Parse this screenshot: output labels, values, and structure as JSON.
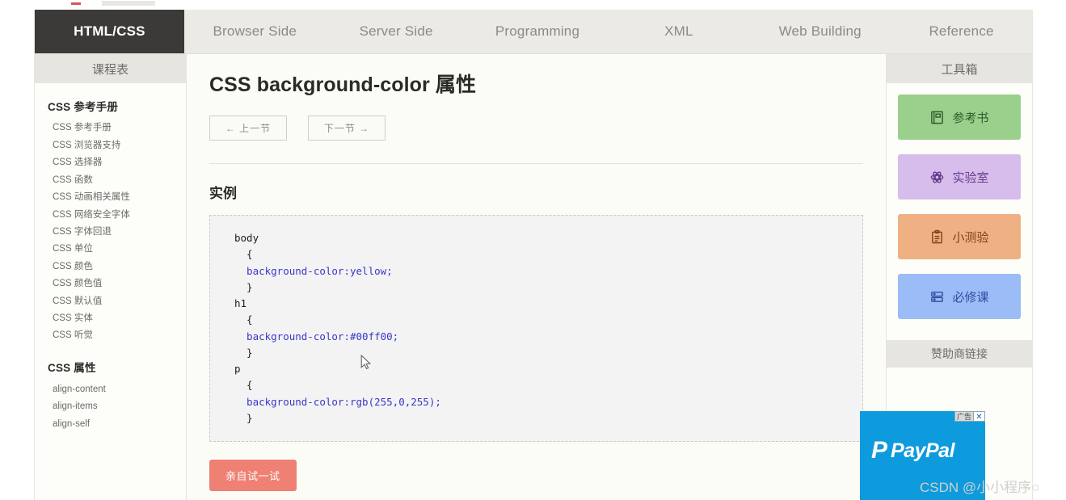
{
  "topnav": {
    "items": [
      {
        "label": "HTML/CSS",
        "active": true
      },
      {
        "label": "Browser Side",
        "active": false
      },
      {
        "label": "Server Side",
        "active": false
      },
      {
        "label": "Programming",
        "active": false
      },
      {
        "label": "XML",
        "active": false
      },
      {
        "label": "Web Building",
        "active": false
      },
      {
        "label": "Reference",
        "active": false
      }
    ]
  },
  "left_sidebar": {
    "header": "课程表",
    "group1_title": "CSS 参考手册",
    "group1_items": [
      "CSS 参考手册",
      "CSS 浏览器支持",
      "CSS 选择器",
      "CSS 函数",
      "CSS 动画相关属性",
      "CSS 网络安全字体",
      "CSS 字体回退",
      "CSS 单位",
      "CSS 颜色",
      "CSS 颜色值",
      "CSS 默认值",
      "CSS 实体",
      "CSS 听觉"
    ],
    "group2_title": "CSS 属性",
    "group2_items": [
      "align-content",
      "align-items",
      "align-self"
    ]
  },
  "main": {
    "title": "CSS background-color 属性",
    "prev_button": "← 上一节",
    "next_button": "下一节 →",
    "example_heading": "实例",
    "code_lines": [
      {
        "text": "body",
        "highlight": false
      },
      {
        "text": "  {",
        "highlight": false
      },
      {
        "text": "  background-color:yellow;",
        "highlight": true
      },
      {
        "text": "  }",
        "highlight": false
      },
      {
        "text": "h1",
        "highlight": false
      },
      {
        "text": "  {",
        "highlight": false
      },
      {
        "text": "  background-color:#00ff00;",
        "highlight": true
      },
      {
        "text": "  }",
        "highlight": false
      },
      {
        "text": "p",
        "highlight": false
      },
      {
        "text": "  {",
        "highlight": false
      },
      {
        "text": "  background-color:rgb(255,0,255);",
        "highlight": true
      },
      {
        "text": "  }",
        "highlight": false
      }
    ],
    "try_button": "亲自试一试"
  },
  "right_sidebar": {
    "header": "工具箱",
    "tools": [
      {
        "label": "参考书",
        "icon": "book-icon",
        "color": "#9ad08c"
      },
      {
        "label": "实验室",
        "icon": "atom-icon",
        "color": "#d6bdec"
      },
      {
        "label": "小测验",
        "icon": "clipboard-icon",
        "color": "#efb183"
      },
      {
        "label": "必修课",
        "icon": "stack-icon",
        "color": "#9bbcf7"
      }
    ],
    "sponsor_header": "赞助商链接"
  },
  "ad": {
    "badge_label": "广告",
    "close_label": "✕",
    "brand_mark": "P",
    "brand_text": "PayPal",
    "background": "#0d9bdd"
  },
  "watermark": "CSDN @小小程序○"
}
